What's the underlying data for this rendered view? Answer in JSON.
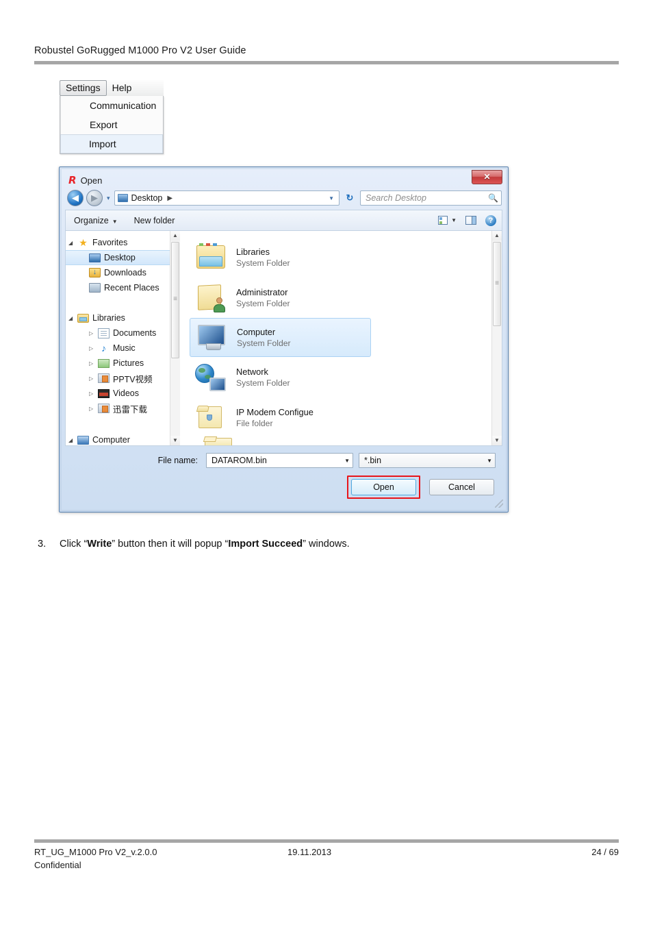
{
  "page": {
    "header_title": "Robustel GoRugged M1000 Pro V2 User Guide"
  },
  "app_menu": {
    "bar": [
      {
        "label": "Settings",
        "active": true
      },
      {
        "label": "Help",
        "active": false
      }
    ],
    "items": [
      {
        "label": "Communication",
        "hover": false
      },
      {
        "label": "Export",
        "hover": false
      },
      {
        "label": "Import",
        "hover": true
      }
    ]
  },
  "dialog": {
    "title": "Open",
    "logo": "robustel-r-logo",
    "close_label": "✕",
    "nav": {
      "back_icon": "◀",
      "forward_icon": "▶",
      "history_caret": "▾",
      "refresh_icon": "↻"
    },
    "address": {
      "icon": "desktop-icon",
      "path": "Desktop",
      "separator": "▶",
      "caret": "▼"
    },
    "search": {
      "placeholder": "Search Desktop",
      "icon": "🔍"
    },
    "toolbar": {
      "organize": "Organize",
      "organize_caret": "▼",
      "new_folder": "New folder",
      "view_caret": "▼",
      "icons": [
        "view-mode-icon",
        "preview-pane-icon",
        "help-icon"
      ],
      "help_glyph": "?"
    },
    "tree": [
      {
        "label": "Favorites",
        "icon": "star-icon",
        "twisty": "◢",
        "level": 0,
        "selected": false
      },
      {
        "label": "Desktop",
        "icon": "desktop-icon",
        "twisty": "",
        "level": 1,
        "selected": true
      },
      {
        "label": "Downloads",
        "icon": "downloads-icon",
        "twisty": "",
        "level": 1,
        "selected": false
      },
      {
        "label": "Recent Places",
        "icon": "recent-places-icon",
        "twisty": "",
        "level": 1,
        "selected": false
      },
      {
        "label": "Libraries",
        "icon": "library-icon",
        "twisty": "◢",
        "level": 0,
        "selected": false,
        "gap_before": true
      },
      {
        "label": "Documents",
        "icon": "document-icon",
        "twisty": "▷",
        "level": 1,
        "selected": false
      },
      {
        "label": "Music",
        "icon": "music-icon",
        "twisty": "▷",
        "level": 1,
        "selected": false
      },
      {
        "label": "Pictures",
        "icon": "pictures-icon",
        "twisty": "▷",
        "level": 1,
        "selected": false
      },
      {
        "label": "PPTV视频",
        "icon": "pptv-icon",
        "twisty": "▷",
        "level": 1,
        "selected": false
      },
      {
        "label": "Videos",
        "icon": "videos-icon",
        "twisty": "▷",
        "level": 1,
        "selected": false
      },
      {
        "label": "迅雷下载",
        "icon": "thunder-icon",
        "twisty": "▷",
        "level": 1,
        "selected": false
      },
      {
        "label": "Computer",
        "icon": "computer-icon",
        "twisty": "◢",
        "level": 0,
        "selected": false,
        "gap_before": true
      }
    ],
    "files": [
      {
        "name": "Libraries",
        "type": "System Folder",
        "icon": "libraries-folder-icon",
        "selected": false
      },
      {
        "name": "Administrator",
        "type": "System Folder",
        "icon": "user-folder-icon",
        "selected": false
      },
      {
        "name": "Computer",
        "type": "System Folder",
        "icon": "computer-icon",
        "selected": true
      },
      {
        "name": "Network",
        "type": "System Folder",
        "icon": "network-icon",
        "selected": false
      },
      {
        "name": "IP Modem Configue",
        "type": "File folder",
        "icon": "folder-icon",
        "selected": false
      }
    ],
    "footer": {
      "file_name_label": "File name:",
      "file_name_value": "DATAROM.bin",
      "filter_value": "*.bin",
      "caret": "▼",
      "open_label": "Open",
      "cancel_label": "Cancel"
    },
    "annotation_color": "#e8151b"
  },
  "instruction": {
    "number": "3.",
    "part1": "Click “",
    "bold1": "Write",
    "part2": "” button then it will popup “",
    "bold2": "Import Succeed",
    "part3": "” windows."
  },
  "doc_footer": {
    "left": "RT_UG_M1000 Pro V2_v.2.0.0",
    "date": "19.11.2013",
    "page": "24 / 69",
    "confidential": "Confidential"
  }
}
